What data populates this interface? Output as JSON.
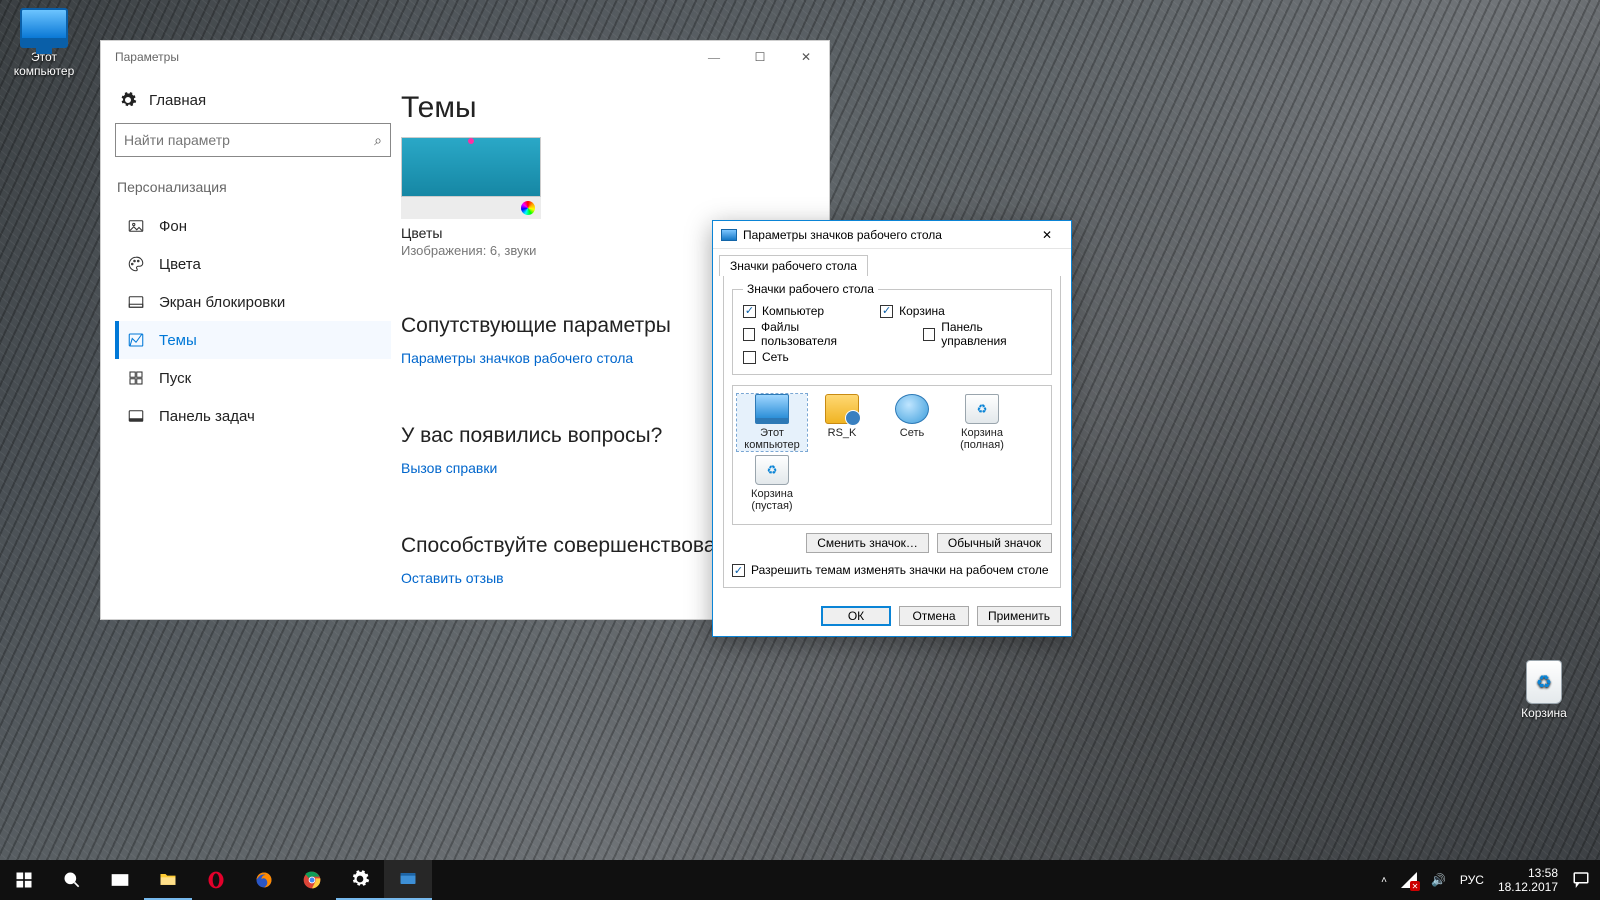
{
  "desktop": {
    "this_pc": "Этот\nкомпьютер",
    "recycle": "Корзина"
  },
  "settings": {
    "title": "Параметры",
    "home": "Главная",
    "search_placeholder": "Найти параметр",
    "category": "Персонализация",
    "nav": {
      "background": "Фон",
      "colors": "Цвета",
      "lockscreen": "Экран блокировки",
      "themes": "Темы",
      "start": "Пуск",
      "taskbar": "Панель задач"
    },
    "main": {
      "heading": "Темы",
      "theme_name": "Цветы",
      "theme_info": "Изображения: 6, звуки",
      "related_h": "Сопутствующие параметры",
      "related_link": "Параметры значков рабочего стола",
      "help_h": "У вас появились вопросы?",
      "help_link": "Вызов справки",
      "feedback_h": "Способствуйте совершенствованию",
      "feedback_link": "Оставить отзыв"
    }
  },
  "dialog": {
    "title": "Параметры значков рабочего стола",
    "tab": "Значки рабочего стола",
    "legend": "Значки рабочего стола",
    "cks": {
      "computer": "Компьютер",
      "recycle": "Корзина",
      "userfiles": "Файлы пользователя",
      "cpanel": "Панель управления",
      "network": "Сеть"
    },
    "icons": {
      "this_pc": "Этот\nкомпьютер",
      "user": "RS_K",
      "network": "Сеть",
      "bin_full": "Корзина\n(полная)",
      "bin_empty": "Корзина\n(пустая)"
    },
    "change_icon": "Сменить значок…",
    "default_icon": "Обычный значок",
    "allow_themes": "Разрешить темам изменять значки на рабочем столе",
    "ok": "ОК",
    "cancel": "Отмена",
    "apply": "Применить"
  },
  "tray": {
    "lang": "РУС",
    "time": "13:58",
    "date": "18.12.2017"
  }
}
